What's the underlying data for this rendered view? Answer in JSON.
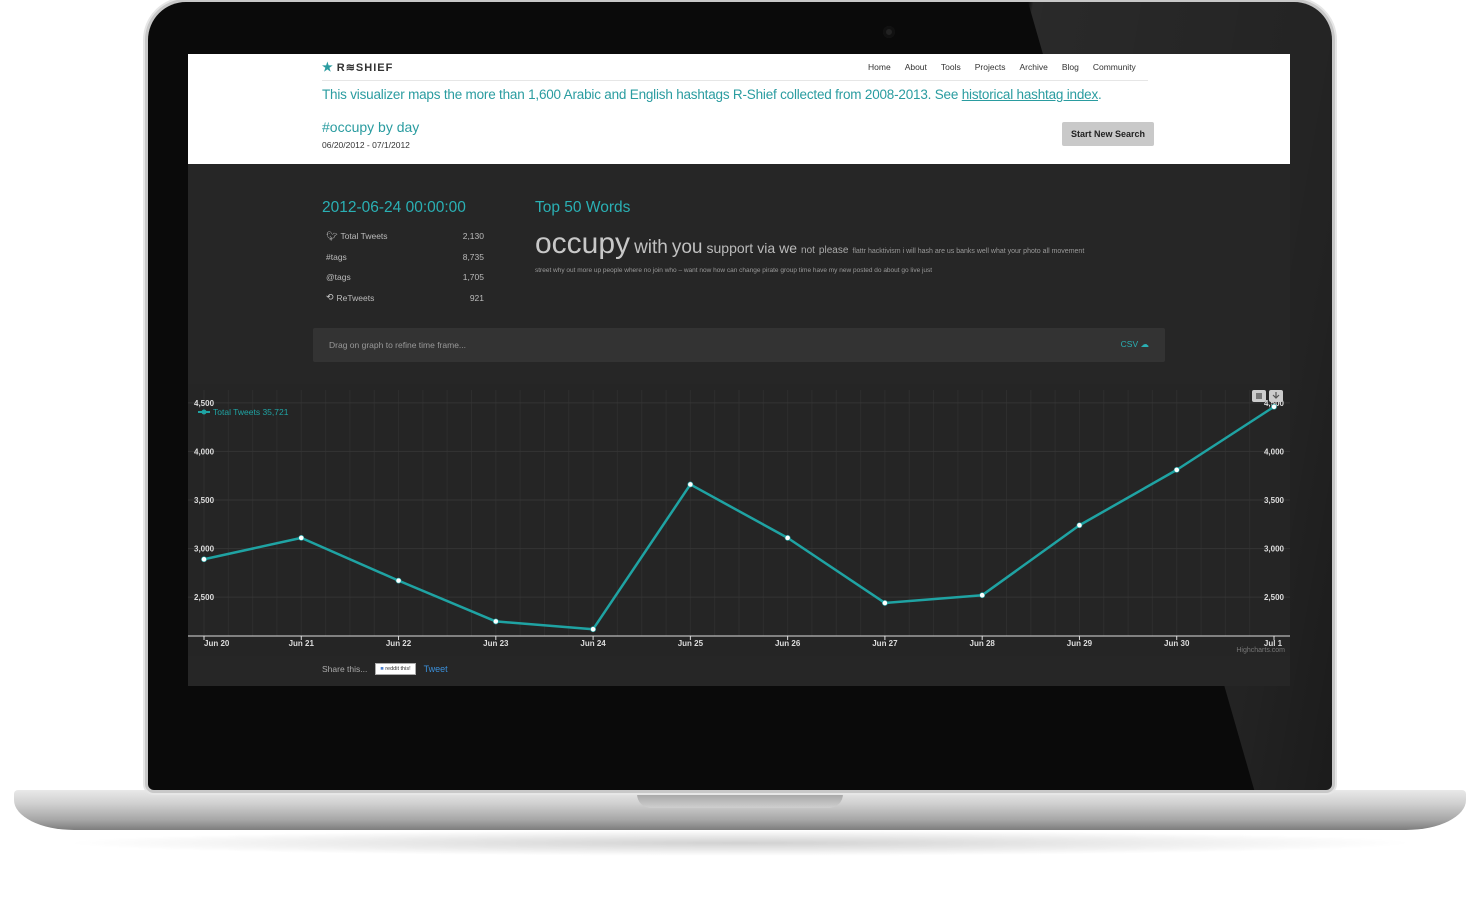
{
  "brand": {
    "logo_text": "R≋SHIEF"
  },
  "nav": {
    "items": [
      "Home",
      "About",
      "Tools",
      "Projects",
      "Archive",
      "Blog",
      "Community"
    ]
  },
  "intro": {
    "text_before": "This visualizer maps the more than 1,600 Arabic and English hashtags R-Shief collected from 2008-2013. See ",
    "link_text": "historical hashtag index",
    "text_after": "."
  },
  "search": {
    "title": "#occupy by day",
    "date_range": "06/20/2012 - 07/1/2012",
    "new_search_label": "Start New Search"
  },
  "stats": {
    "date": "2012-06-24 00:00:00",
    "rows": [
      {
        "icon": "twitter-bird-icon",
        "label": "Total Tweets",
        "value": "2,130"
      },
      {
        "icon": "",
        "label": "#tags",
        "value": "8,735"
      },
      {
        "icon": "",
        "label": "@tags",
        "value": "1,705"
      },
      {
        "icon": "retweet-icon",
        "label": "ReTweets",
        "value": "921"
      }
    ]
  },
  "words": {
    "title": "Top 50 Words",
    "xl": [
      "occupy"
    ],
    "l": [
      "with",
      "you"
    ],
    "m": [
      "support",
      "via",
      "we"
    ],
    "s": [
      "not",
      "please"
    ],
    "xs_line1": "flattr hacktivism i will hash are us banks well what your photo all movement",
    "line2": "street why out more up people where no join who – want now how can change pirate group time have my new posted do about go live just"
  },
  "toolbar": {
    "drag_hint": "Drag on graph to refine time frame...",
    "csv_label": "CSV"
  },
  "share": {
    "label": "Share this...",
    "reddit_label": "reddit this!",
    "tweet_label": "Tweet"
  },
  "colors": {
    "accent": "#2ab0b4",
    "line": "#1fa3a3",
    "panel": "#262626"
  },
  "chart_data": {
    "type": "line",
    "legend": "Total Tweets 35,721",
    "credit": "Highcharts.com",
    "x": [
      "Jun 20",
      "Jun 21",
      "Jun 22",
      "Jun 23",
      "Jun 24",
      "Jun 25",
      "Jun 26",
      "Jun 27",
      "Jun 28",
      "Jun 29",
      "Jun 30",
      "Jul 1"
    ],
    "series": [
      {
        "name": "Total Tweets",
        "values": [
          2890,
          3110,
          2670,
          2250,
          2170,
          3660,
          3110,
          2440,
          2520,
          3240,
          3810,
          4460
        ]
      }
    ],
    "yticks": [
      "2,500",
      "3,000",
      "3,500",
      "4,000",
      "4,500"
    ],
    "ylim": [
      2100,
      4550
    ],
    "grid": true,
    "legend_position": "top-left"
  }
}
